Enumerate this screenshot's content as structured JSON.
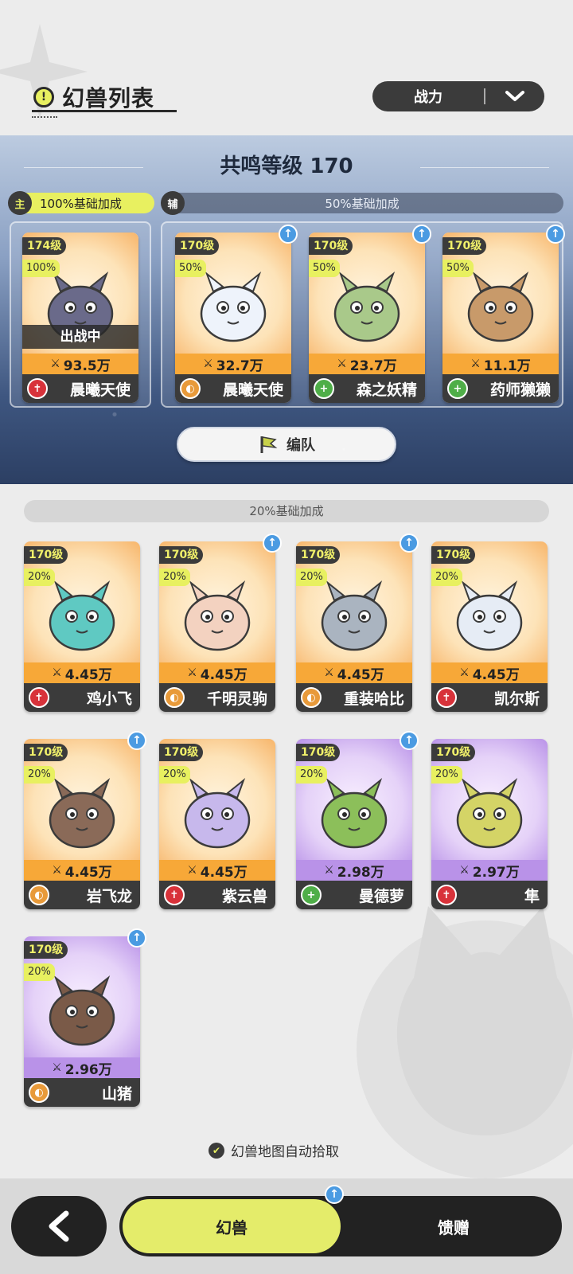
{
  "header": {
    "title": "幻兽列表",
    "title_icon": "!",
    "sort_label": "战力"
  },
  "resonance": {
    "title": "共鸣等级 170",
    "main_tag": "主",
    "main_bonus": "100%基础加成",
    "sub_tag": "辅",
    "sub_bonus": "50%基础加成",
    "team_button": "编队"
  },
  "team_cards": [
    {
      "level": "174级",
      "pct": "100%",
      "power": "93.5万",
      "name": "晨曦天使",
      "role": "attack",
      "in_battle": "出战中",
      "theme": "orange",
      "upgrade": false
    },
    {
      "level": "170级",
      "pct": "50%",
      "power": "32.7万",
      "name": "晨曦天使",
      "role": "defense",
      "theme": "orange",
      "upgrade": true
    },
    {
      "level": "170级",
      "pct": "50%",
      "power": "23.7万",
      "name": "森之妖精",
      "role": "heal",
      "theme": "orange",
      "upgrade": true
    },
    {
      "level": "170级",
      "pct": "50%",
      "power": "11.1万",
      "name": "药师獭獭",
      "role": "heal",
      "theme": "orange",
      "upgrade": true
    }
  ],
  "list_bonus": "20%基础加成",
  "beasts": [
    {
      "level": "170级",
      "pct": "20%",
      "power": "4.45万",
      "name": "鸡小飞",
      "role": "attack",
      "theme": "orange",
      "upgrade": false
    },
    {
      "level": "170级",
      "pct": "20%",
      "power": "4.45万",
      "name": "千明灵驹",
      "role": "defense",
      "theme": "orange",
      "upgrade": true
    },
    {
      "level": "170级",
      "pct": "20%",
      "power": "4.45万",
      "name": "重装哈比",
      "role": "defense",
      "theme": "orange",
      "upgrade": true
    },
    {
      "level": "170级",
      "pct": "20%",
      "power": "4.45万",
      "name": "凯尔斯",
      "role": "attack",
      "theme": "orange",
      "upgrade": false
    },
    {
      "level": "170级",
      "pct": "20%",
      "power": "4.45万",
      "name": "岩飞龙",
      "role": "defense",
      "theme": "orange",
      "upgrade": true
    },
    {
      "level": "170级",
      "pct": "20%",
      "power": "4.45万",
      "name": "紫云兽",
      "role": "attack",
      "theme": "orange",
      "upgrade": false
    },
    {
      "level": "170级",
      "pct": "20%",
      "power": "2.98万",
      "name": "曼德萝",
      "role": "heal",
      "theme": "purple",
      "upgrade": true
    },
    {
      "level": "170级",
      "pct": "20%",
      "power": "2.97万",
      "name": "隼",
      "role": "attack",
      "theme": "purple",
      "upgrade": false
    },
    {
      "level": "170级",
      "pct": "20%",
      "power": "2.96万",
      "name": "山猪",
      "role": "defense",
      "theme": "purple",
      "upgrade": true
    }
  ],
  "auto_pickup": "幻兽地图自动拾取",
  "nav": {
    "tab_active": "幻兽",
    "tab_other": "馈赠"
  },
  "colors": {
    "accent": "#e8f060",
    "dark": "#3b3b3b",
    "orange": "#f7a838",
    "purple": "#b992e8",
    "attack": "#d8323a",
    "defense": "#e89a3a",
    "heal": "#4fae48",
    "upgrade": "#4b9be2"
  },
  "icons": {
    "role_attack": "sword-icon",
    "role_defense": "shield-icon",
    "role_heal": "plus-icon",
    "power": "crossed-swords-icon",
    "upgrade": "arrow-up-icon",
    "back": "chevron-left-icon",
    "sort": "chevron-down-icon"
  }
}
